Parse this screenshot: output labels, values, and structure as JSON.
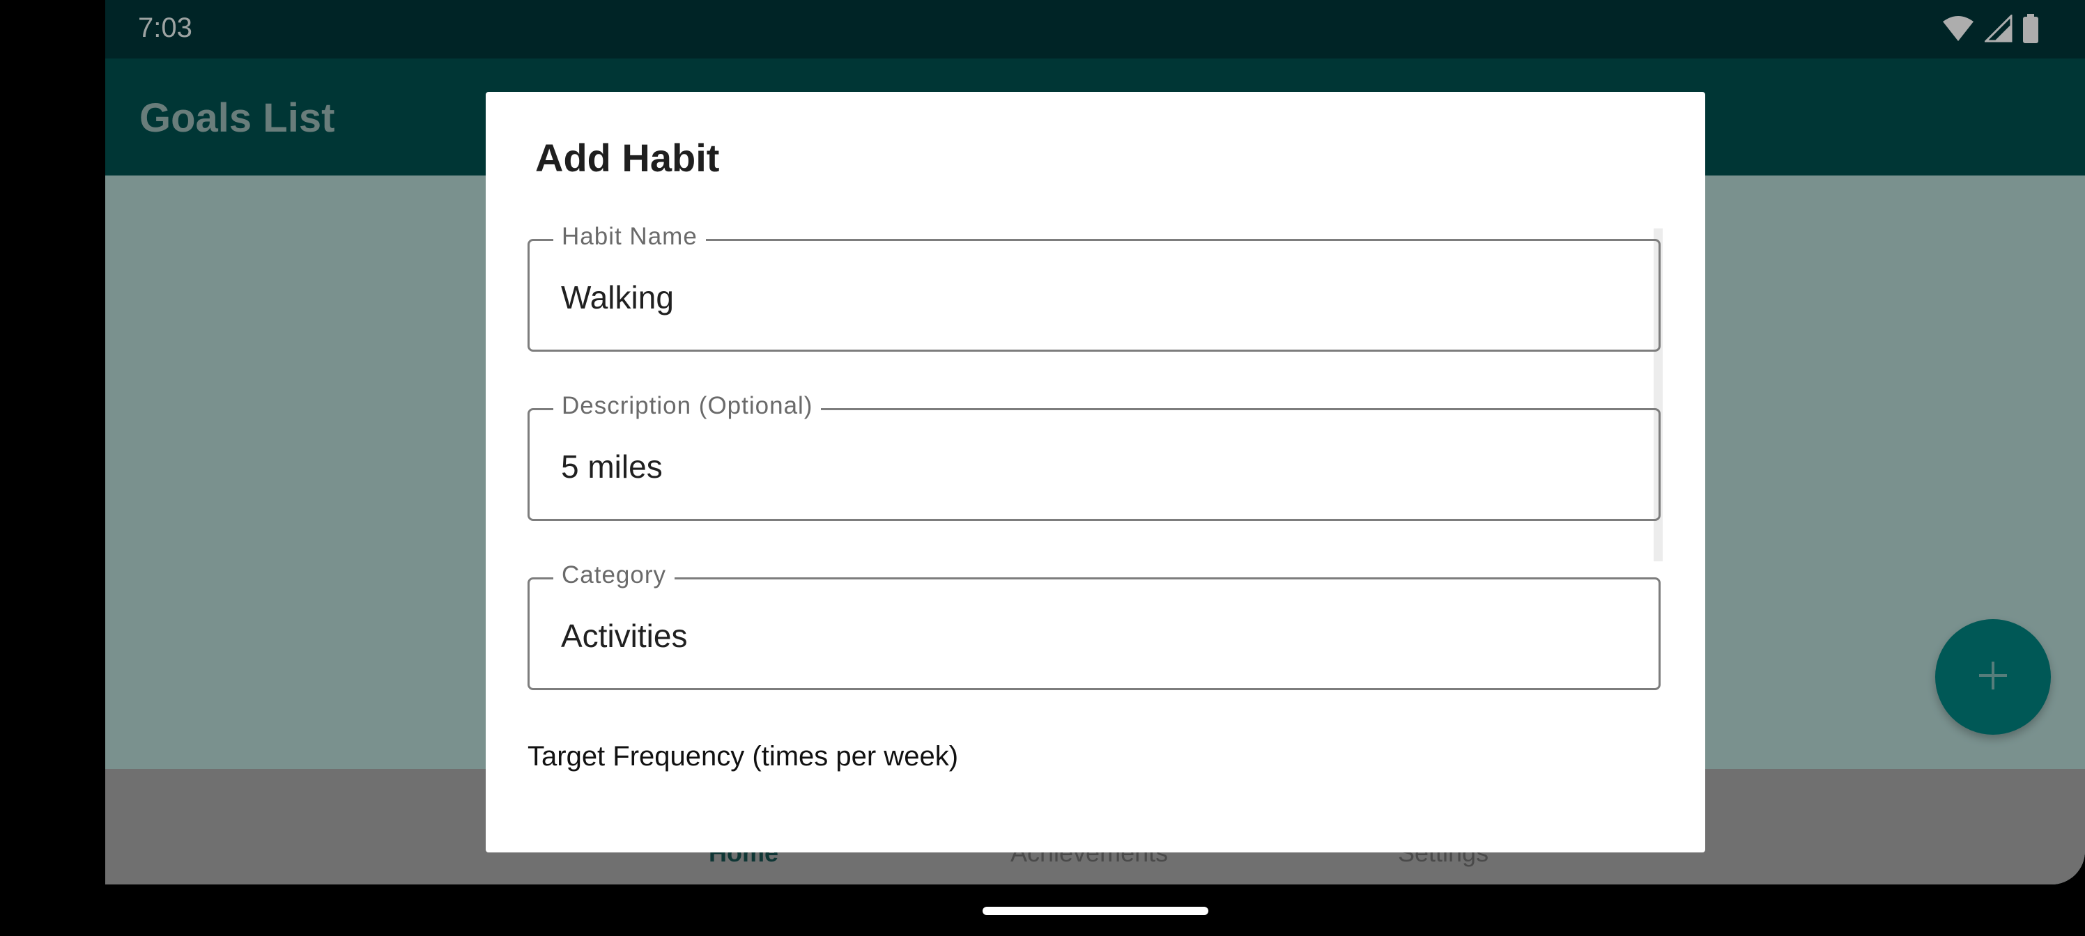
{
  "status_bar": {
    "time": "7:03",
    "icons": [
      "wifi-icon",
      "signal-icon",
      "battery-icon"
    ]
  },
  "app_bar": {
    "title": "Goals List"
  },
  "bottom_nav": {
    "items": [
      {
        "label": "Home",
        "selected": true
      },
      {
        "label": "Achievements",
        "selected": false
      },
      {
        "label": "Settings",
        "selected": false
      }
    ]
  },
  "fab": {
    "icon": "plus-icon"
  },
  "dialog": {
    "title": "Add Habit",
    "fields": [
      {
        "label": "Habit Name",
        "value": "Walking"
      },
      {
        "label": "Description (Optional)",
        "value": "5 miles"
      },
      {
        "label": "Category",
        "value": "Activities"
      }
    ],
    "target_frequency_label": "Target Frequency (times per week)"
  },
  "colors": {
    "status_bar": "#003538",
    "app_bar": "#00504f",
    "fab": "#00827f",
    "dialog_background": "#ffffff"
  }
}
